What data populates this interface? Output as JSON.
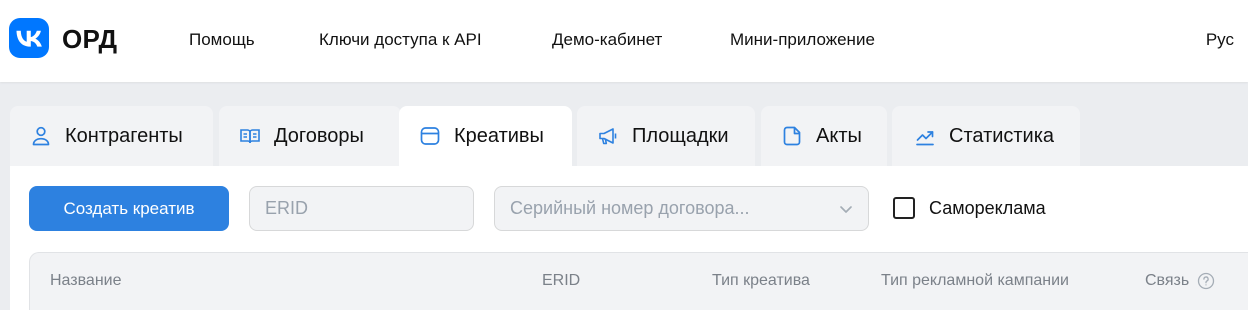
{
  "header": {
    "brand": "ОРД",
    "logo_icon": "vk-logo",
    "nav": [
      "Помощь",
      "Ключи доступа к API",
      "Демо-кабинет",
      "Мини-приложение"
    ],
    "language": "Рус"
  },
  "tabs": [
    {
      "label": "Контрагенты",
      "icon": "user-icon",
      "active": false
    },
    {
      "label": "Договоры",
      "icon": "book-icon",
      "active": false
    },
    {
      "label": "Креативы",
      "icon": "card-icon",
      "active": true
    },
    {
      "label": "Площадки",
      "icon": "megaphone-icon",
      "active": false
    },
    {
      "label": "Акты",
      "icon": "document-icon",
      "active": false
    },
    {
      "label": "Статистика",
      "icon": "trend-chart-icon",
      "active": false
    }
  ],
  "toolbar": {
    "create_label": "Создать креатив",
    "erid_placeholder": "ERID",
    "contract_placeholder": "Серийный номер договора...",
    "self_ad_label": "Самореклама",
    "self_ad_checked": false
  },
  "table": {
    "columns": [
      "Название",
      "ERID",
      "Тип креатива",
      "Тип рекламной кампании",
      "Связь"
    ]
  },
  "colors": {
    "primary": "#2d81e0",
    "vk_blue": "#0077ff",
    "background": "#ebedf0",
    "tab_inactive": "#f2f3f5",
    "muted_text": "#7b8189"
  }
}
